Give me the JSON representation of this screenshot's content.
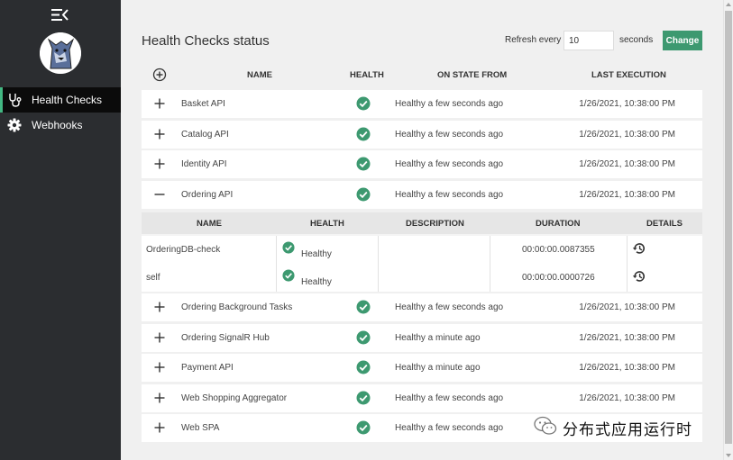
{
  "sidebar": {
    "nav": [
      {
        "label": "Health Checks",
        "icon": "stethoscope-icon",
        "active": true
      },
      {
        "label": "Webhooks",
        "icon": "gear-icon",
        "active": false
      }
    ]
  },
  "header": {
    "title": "Health Checks status",
    "refresh_label": "Refresh every",
    "refresh_value": "10",
    "seconds_label": "seconds",
    "change_label": "Change"
  },
  "table": {
    "columns": [
      "NAME",
      "HEALTH",
      "ON STATE FROM",
      "LAST EXECUTION"
    ],
    "rows": [
      {
        "name": "Basket API",
        "state": "Healthy a few seconds ago",
        "last_execution": "1/26/2021, 10:38:00 PM",
        "expanded": false
      },
      {
        "name": "Catalog API",
        "state": "Healthy a few seconds ago",
        "last_execution": "1/26/2021, 10:38:00 PM",
        "expanded": false
      },
      {
        "name": "Identity API",
        "state": "Healthy a few seconds ago",
        "last_execution": "1/26/2021, 10:38:00 PM",
        "expanded": false
      },
      {
        "name": "Ordering API",
        "state": "Healthy a few seconds ago",
        "last_execution": "1/26/2021, 10:38:00 PM",
        "expanded": true
      },
      {
        "name": "Ordering Background Tasks",
        "state": "Healthy a few seconds ago",
        "last_execution": "1/26/2021, 10:38:00 PM",
        "expanded": false
      },
      {
        "name": "Ordering SignalR Hub",
        "state": "Healthy a minute ago",
        "last_execution": "1/26/2021, 10:38:00 PM",
        "expanded": false
      },
      {
        "name": "Payment API",
        "state": "Healthy a minute ago",
        "last_execution": "1/26/2021, 10:38:00 PM",
        "expanded": false
      },
      {
        "name": "Web Shopping Aggregator",
        "state": "Healthy a few seconds ago",
        "last_execution": "1/26/2021, 10:38:00 PM",
        "expanded": false
      },
      {
        "name": "Web SPA",
        "state": "Healthy a few seconds ago",
        "last_execution": "1/26/2021, 10:38:00 PM",
        "expanded": false
      }
    ]
  },
  "details": {
    "columns": [
      "NAME",
      "HEALTH",
      "DESCRIPTION",
      "DURATION",
      "DETAILS"
    ],
    "rows": [
      {
        "name": "OrderingDB-check",
        "health": "Healthy",
        "description": "",
        "duration": "00:00:00.0087355"
      },
      {
        "name": "self",
        "health": "Healthy",
        "description": "",
        "duration": "00:00:00.0000726"
      }
    ]
  },
  "watermark": {
    "text": "分布式应用运行时"
  },
  "colors": {
    "accent": "#3d9970",
    "healthy": "#3d9970",
    "sidebar": "#2b2d30"
  }
}
